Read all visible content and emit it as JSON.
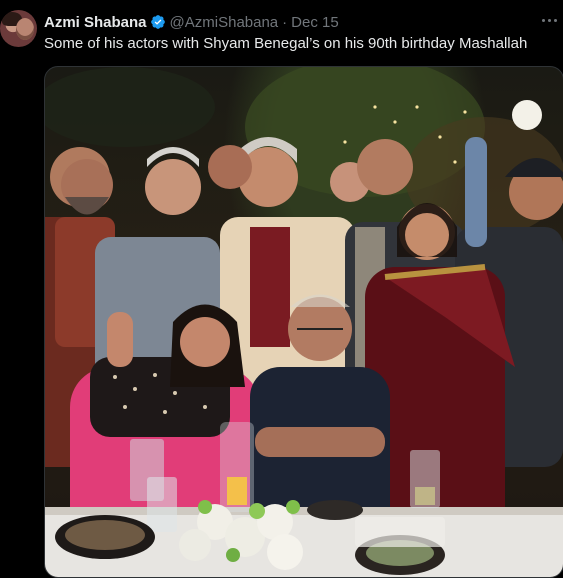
{
  "tweet": {
    "author_name": "Azmi Shabana",
    "handle": "@AzmiShabana",
    "separator": "·",
    "date": "Dec 15",
    "text": "Some of his actors with Shyam Benegal’s on his 90th birthday Mashallah",
    "verified": true,
    "icons": {
      "verified": "verified-badge-icon",
      "more": "more-options-icon"
    },
    "colors": {
      "background": "#000000",
      "primary_text": "#e7e9ea",
      "secondary_text": "#71767b",
      "verified_blue": "#1d9bf0"
    }
  }
}
